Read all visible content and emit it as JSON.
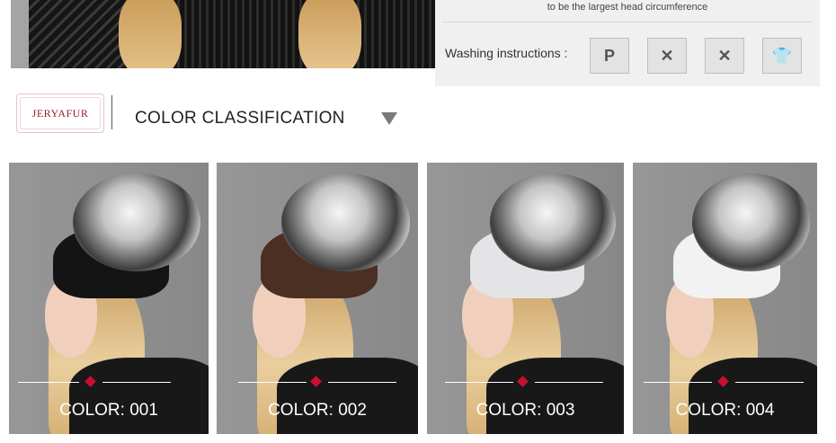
{
  "info": {
    "circumference_note": "to be the largest head circumference",
    "washing_label": "Washing instructions :",
    "wash_icons": [
      {
        "name": "dry-clean-p-icon",
        "glyph": "P"
      },
      {
        "name": "no-machine-wash-icon",
        "glyph": "✕"
      },
      {
        "name": "no-bleach-icon",
        "glyph": "✕"
      },
      {
        "name": "hang-dry-icon",
        "glyph": "👕"
      }
    ]
  },
  "brand": {
    "logo_text": "JERYAFUR"
  },
  "section": {
    "title": "COLOR CLASSIFICATION"
  },
  "products": [
    {
      "label": "COLOR: 001",
      "hat_base_color": "#141414"
    },
    {
      "label": "COLOR: 002",
      "hat_base_color": "#4a2f22"
    },
    {
      "label": "COLOR: 003",
      "hat_base_color": "#e4e4e6"
    },
    {
      "label": "COLOR: 004",
      "hat_base_color": "#f2f2f2"
    }
  ],
  "colors": {
    "accent": "#c8102e",
    "brand": "#9b1b2e"
  }
}
